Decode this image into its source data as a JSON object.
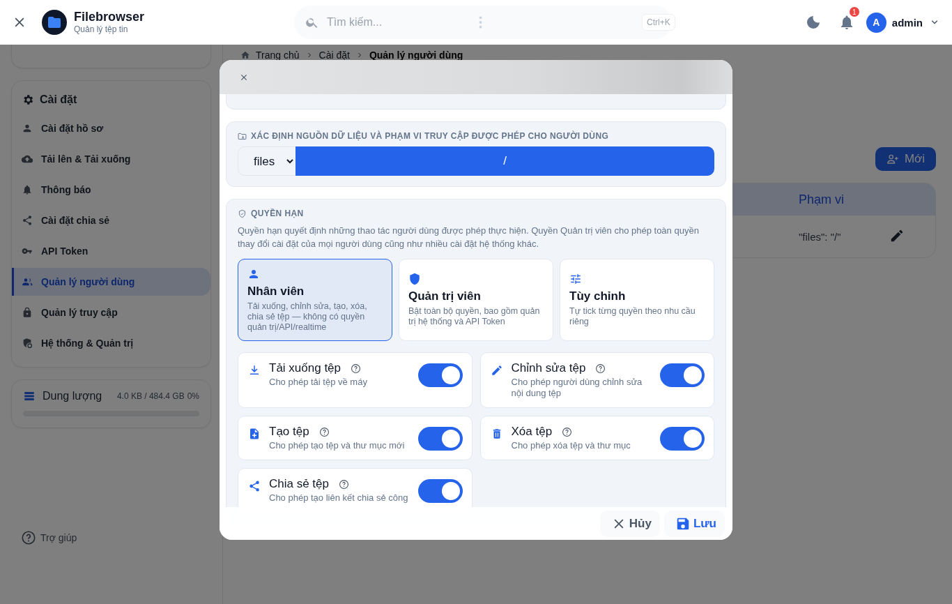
{
  "header": {
    "title": "Filebrowser",
    "subtitle": "Quản lý tệp tin",
    "search": {
      "placeholder": "Tìm kiếm...",
      "shortcut": "Ctrl+K"
    },
    "notifications": {
      "badge": "1"
    },
    "user": {
      "avatar": "A",
      "name": "admin"
    }
  },
  "sidebar": {
    "settings": {
      "title": "Cài đặt",
      "items": [
        {
          "label": "Cài đặt hồ sơ",
          "selected": false
        },
        {
          "label": "Tải lên & Tải xuống",
          "selected": false
        },
        {
          "label": "Thông báo",
          "selected": false
        },
        {
          "label": "Cài đặt chia sẻ",
          "selected": false
        },
        {
          "label": "API Token",
          "selected": false
        },
        {
          "label": "Quản lý người dùng",
          "selected": true
        },
        {
          "label": "Quản lý truy cập",
          "selected": false
        },
        {
          "label": "Hệ thống & Quản trị",
          "selected": false
        }
      ]
    },
    "storage": {
      "title": "Dung lượng",
      "usage": "4.0 KB / 484.4 GB",
      "percent": "0%",
      "level": 0
    },
    "help": "Trợ giúp"
  },
  "main": {
    "breadcrumb": [
      "Trang chủ",
      "Cài đặt",
      "Quản lý người dùng"
    ],
    "new_button": "Mới",
    "table": {
      "columns": [
        "Phạm vi"
      ],
      "rows": [
        {
          "scope": "\"files\": \"/\""
        }
      ]
    }
  },
  "modal": {
    "source": {
      "title": "XÁC ĐỊNH NGUỒN DỮ LIỆU VÀ PHẠM VI TRUY CẬP ĐƯỢC PHÉP CHO NGƯỜI DÙNG",
      "source": "files",
      "path": "/"
    },
    "permissions": {
      "title": "QUYỀN HẠN",
      "description": "Quyền hạn quyết định những thao tác người dùng được phép thực hiện. Quyền Quản trị viên cho phép toàn quyền thay đổi cài đặt của mọi người dùng cũng như nhiều cài đặt hệ thống khác.",
      "roles": [
        {
          "title": "Nhân viên",
          "description": "Tải xuống, chỉnh sửa, tạo, xóa, chia sẻ tệp — không có quyền quản trị/API/realtime",
          "selected": true
        },
        {
          "title": "Quản trị viên",
          "description": "Bật toàn bộ quyền, bao gồm quản trị hệ thống và API Token",
          "selected": false
        },
        {
          "title": "Tùy chỉnh",
          "description": "Tự tick từng quyền theo nhu cầu riêng",
          "selected": false
        }
      ],
      "toggles": [
        {
          "label": "Tải xuống tệp",
          "description": "Cho phép tải tệp về máy",
          "on": true
        },
        {
          "label": "Chỉnh sửa tệp",
          "description": "Cho phép người dùng chỉnh sửa nội dung tệp",
          "on": true
        },
        {
          "label": "Tạo tệp",
          "description": "Cho phép tạo tệp và thư mục mới",
          "on": true
        },
        {
          "label": "Xóa tệp",
          "description": "Cho phép xóa tệp và thư mục",
          "on": true
        },
        {
          "label": "Chia sẻ tệp",
          "description": "Cho phép tạo liên kết chia sẻ công",
          "on": true
        }
      ]
    },
    "buttons": [
      {
        "label": "Hủy",
        "kind": "cancel"
      },
      {
        "label": "Lưu",
        "kind": "save"
      }
    ]
  }
}
